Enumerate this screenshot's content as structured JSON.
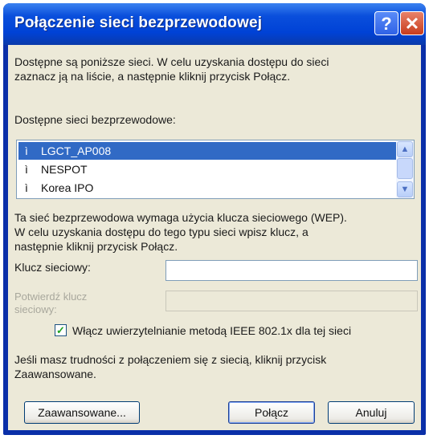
{
  "window": {
    "title": "Połączenie sieci bezprzewodowej",
    "help_symbol": "?",
    "close_symbol": "✕"
  },
  "intro": {
    "line1": "Dostępne są poniższe sieci. W celu uzyskania dostępu do sieci",
    "line2": "zaznacz ją na liście, a następnie kliknij przycisk Połącz."
  },
  "networks": {
    "label": "Dostępne sieci bezprzewodowe:",
    "items": [
      {
        "name": "LGCT_AP008",
        "selected": true
      },
      {
        "name": "NESPOT",
        "selected": false
      },
      {
        "name": "Korea IPO",
        "selected": false
      }
    ]
  },
  "wep_info": {
    "line1": "Ta sieć bezprzewodowa wymaga użycia klucza sieciowego (WEP).",
    "line2": "W celu uzyskania dostępu do tego typu sieci wpisz klucz, a",
    "line3": "następnie kliknij przycisk Połącz."
  },
  "key_field": {
    "label": "Klucz sieciowy:",
    "value": ""
  },
  "confirm_field": {
    "label_line1": "Potwierdź klucz",
    "label_line2": "sieciowy:",
    "value": ""
  },
  "ieee_checkbox": {
    "label": "Włącz uwierzytelnianie metodą IEEE 802.1x dla tej sieci",
    "checked": true
  },
  "help_text": {
    "line1": "Jeśli masz trudności z połączeniem się z siecią, kliknij przycisk",
    "line2": "Zaawansowane."
  },
  "buttons": {
    "advanced": "Zaawansowane...",
    "connect": "Połącz",
    "cancel": "Anuluj"
  },
  "colors": {
    "titlebar": "#0042d6",
    "selection": "#316ac5",
    "dialog_bg": "#ece9d8"
  }
}
